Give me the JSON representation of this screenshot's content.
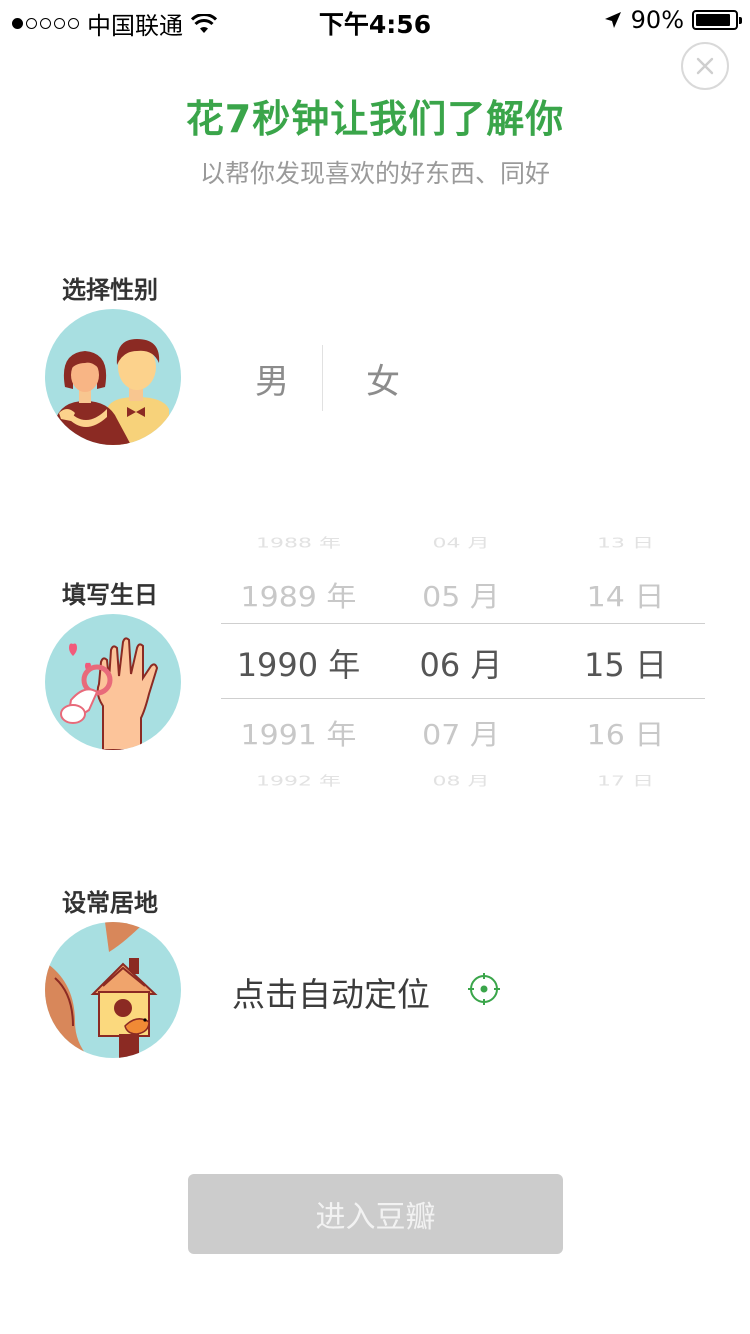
{
  "status_bar": {
    "carrier": "中国联通",
    "time": "下午4:56",
    "battery": "90%",
    "battery_level": 0.9
  },
  "header": {
    "title": "花7秒钟让我们了解你",
    "subtitle": "以帮你发现喜欢的好东西、同好"
  },
  "gender": {
    "label": "选择性别",
    "male": "男",
    "female": "女"
  },
  "birthday": {
    "label": "填写生日",
    "rows": [
      {
        "year": "1988 年",
        "month": "04 月",
        "day": "13 日"
      },
      {
        "year": "1989 年",
        "month": "05 月",
        "day": "14 日"
      },
      {
        "year": "1990 年",
        "month": "06 月",
        "day": "15 日"
      },
      {
        "year": "1991 年",
        "month": "07 月",
        "day": "16 日"
      },
      {
        "year": "1992 年",
        "month": "08 月",
        "day": "17 日"
      }
    ]
  },
  "location": {
    "label": "设常居地",
    "action": "点击自动定位"
  },
  "footer": {
    "enter_label": "进入豆瓣"
  },
  "colors": {
    "accent": "#3aa54a",
    "avatar_bg": "#a8dfe1",
    "button_disabled": "#cccccc"
  }
}
